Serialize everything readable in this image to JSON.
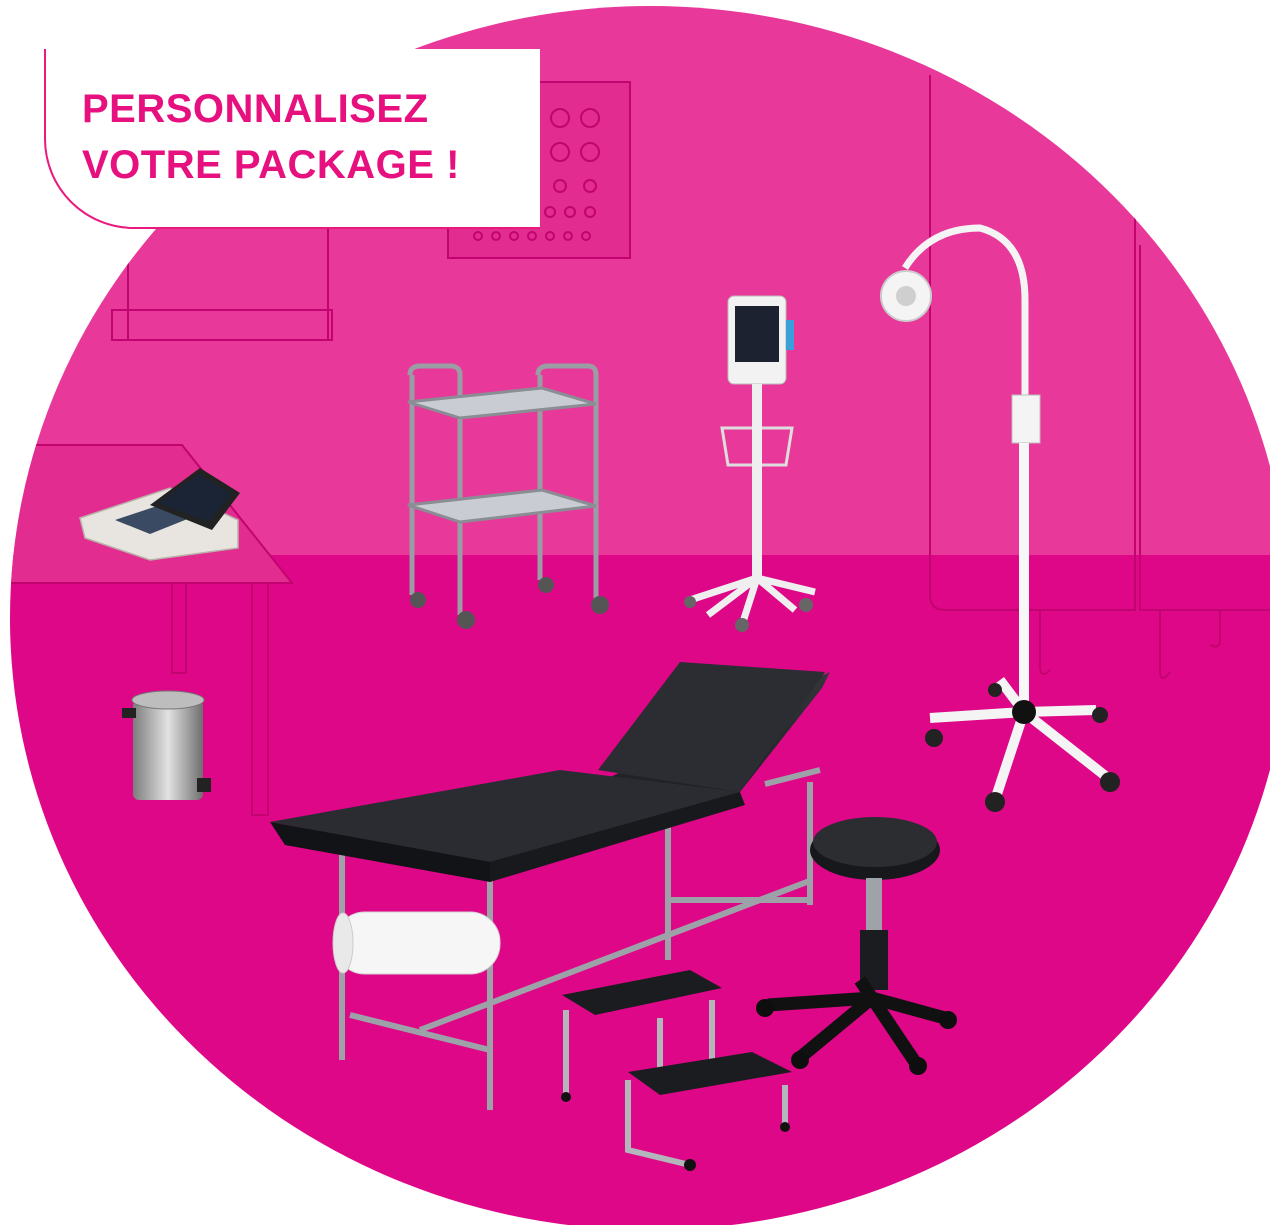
{
  "badge": {
    "line1": "PERSONNALISEZ",
    "line2": "VOTRE PACKAGE !"
  },
  "colors": {
    "background": "#ffffff",
    "circle_wall": "#e8399a",
    "circle_floor": "#de0787",
    "accent_text": "#e6117e",
    "outline": "#c20470"
  },
  "equipment": [
    "wall-cabinet",
    "pegboard",
    "instrument-trolley",
    "vital-signs-monitor",
    "examination-lamp",
    "screen-divider",
    "ecg-device",
    "desk",
    "pedal-bin",
    "examination-couch",
    "paper-roll",
    "step-stool",
    "rolling-stool"
  ]
}
